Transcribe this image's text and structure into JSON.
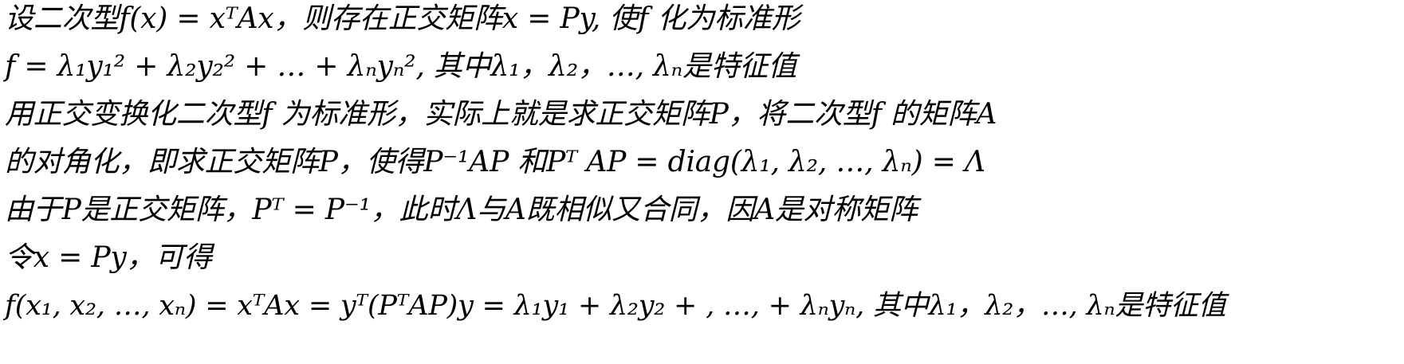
{
  "document": {
    "lines": [
      "设二次型f(x) = xᵀAx，则存在正交矩阵x = Py, 使f 化为标准形",
      "f = λ₁y₁² + λ₂y₂² + … + λₙyₙ², 其中λ₁，λ₂，…, λₙ是特征值",
      "用正交变换化二次型f 为标准形，实际上就是求正交矩阵P，将二次型f 的矩阵A",
      "的对角化，即求正交矩阵P，使得P⁻¹AP 和Pᵀ AP = diag(λ₁, λ₂, …, λₙ) = Λ",
      "由于P是正交矩阵，Pᵀ = P⁻¹，此时Λ与A既相似又合同，因A是对称矩阵",
      "令x = Py，可得",
      "f(x₁, x₂, …, xₙ) = xᵀAx = yᵀ(PᵀAP)y = λ₁y₁ + λ₂y₂ + , …, + λₙyₙ, 其中λ₁，λ₂，…, λₙ是特征值"
    ]
  }
}
